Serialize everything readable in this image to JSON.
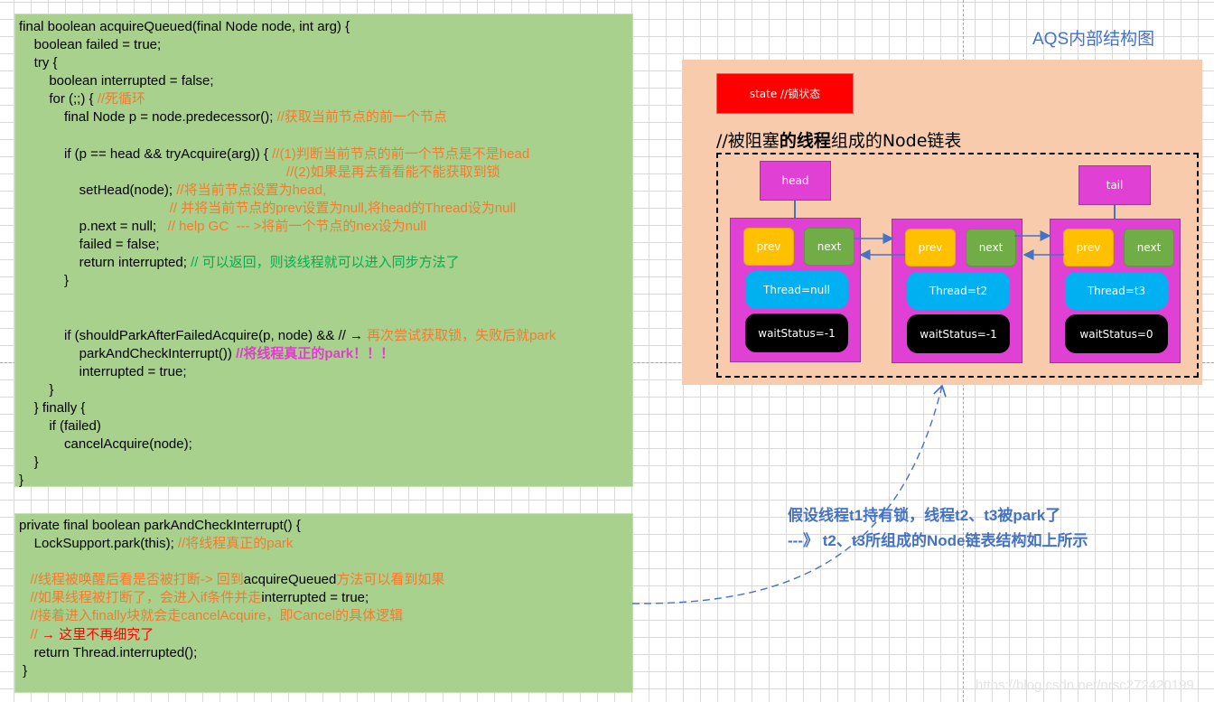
{
  "code_block_1": {
    "lines": [
      [
        {
          "t": "final boolean acquireQueued(final Node node, int arg) {",
          "c": ""
        }
      ],
      [
        {
          "t": "    boolean failed = true;",
          "c": ""
        }
      ],
      [
        {
          "t": "    try {",
          "c": ""
        }
      ],
      [
        {
          "t": "        boolean interrupted = false;",
          "c": ""
        }
      ],
      [
        {
          "t": "        for (;;) { ",
          "c": ""
        },
        {
          "t": "//死循环",
          "c": "c-orange"
        }
      ],
      [
        {
          "t": "            final Node p = node.predecessor(); ",
          "c": ""
        },
        {
          "t": "//获取当前节点的前一个节点",
          "c": "c-orange"
        }
      ],
      [
        {
          "t": "",
          "c": ""
        }
      ],
      [
        {
          "t": "            if (p == head && tryAcquire(arg)) { ",
          "c": ""
        },
        {
          "t": "//(1)判断当前节点的前一个节点是不是head",
          "c": "c-orange"
        }
      ],
      [
        {
          "t": "                                                                       ",
          "c": ""
        },
        {
          "t": "//(2)如果是再去看看能不能获取到锁",
          "c": "c-orange"
        }
      ],
      [
        {
          "t": "                setHead(node); ",
          "c": ""
        },
        {
          "t": "//将当前节点设置为head,",
          "c": "c-orange"
        }
      ],
      [
        {
          "t": "                                        ",
          "c": ""
        },
        {
          "t": "// 并将当前节点的prev设置为null,将head的Thread设为null",
          "c": "c-orange"
        }
      ],
      [
        {
          "t": "                p.next = null;   ",
          "c": ""
        },
        {
          "t": "// help GC  --- >将前一个节点的nex设为null",
          "c": "c-orange"
        }
      ],
      [
        {
          "t": "                failed = false;",
          "c": ""
        }
      ],
      [
        {
          "t": "                return interrupted; ",
          "c": ""
        },
        {
          "t": "// 可以返回，则该线程就可以进入同步方法了",
          "c": "c-green"
        }
      ],
      [
        {
          "t": "            }",
          "c": ""
        }
      ],
      [
        {
          "t": "",
          "c": ""
        }
      ],
      [
        {
          "t": "",
          "c": ""
        }
      ],
      [
        {
          "t": "            if (shouldParkAfterFailedAcquire(p, node) && // → ",
          "c": ""
        },
        {
          "t": "再次尝试获取锁，失败后就park",
          "c": "c-orange"
        }
      ],
      [
        {
          "t": "                parkAndCheckInterrupt()) ",
          "c": ""
        },
        {
          "t": "//将线程真正的park！！！",
          "c": "c-magenta"
        }
      ],
      [
        {
          "t": "                interrupted = true;",
          "c": ""
        }
      ],
      [
        {
          "t": "        }",
          "c": ""
        }
      ],
      [
        {
          "t": "    } finally {",
          "c": ""
        }
      ],
      [
        {
          "t": "        if (failed)",
          "c": ""
        }
      ],
      [
        {
          "t": "            cancelAcquire(node);",
          "c": ""
        }
      ],
      [
        {
          "t": "    }",
          "c": ""
        }
      ],
      [
        {
          "t": "}",
          "c": ""
        }
      ]
    ]
  },
  "code_block_2": {
    "lines": [
      [
        {
          "t": "private final boolean parkAndCheckInterrupt() {",
          "c": ""
        }
      ],
      [
        {
          "t": "    LockSupport.park(this); ",
          "c": ""
        },
        {
          "t": "//将线程真正的park",
          "c": "c-orange"
        }
      ],
      [
        {
          "t": "",
          "c": ""
        }
      ],
      [
        {
          "t": "   ",
          "c": ""
        },
        {
          "t": "//线程被唤醒后看是否被打断-> 回到",
          "c": "c-orange"
        },
        {
          "t": "acquireQueued",
          "c": ""
        },
        {
          "t": "方法可以看到如果",
          "c": "c-orange"
        }
      ],
      [
        {
          "t": "   ",
          "c": ""
        },
        {
          "t": "//如果线程被打断了，会进入if条件并走",
          "c": "c-orange"
        },
        {
          "t": "interrupted = true;",
          "c": ""
        }
      ],
      [
        {
          "t": "   ",
          "c": ""
        },
        {
          "t": "//接着进入finally块就会走cancelAcquire，即Cancel的具体逻辑",
          "c": "c-orange"
        }
      ],
      [
        {
          "t": "   ",
          "c": ""
        },
        {
          "t": "// ",
          "c": "c-orange"
        },
        {
          "t": "→ 这里不再细究了",
          "c": "c-red"
        }
      ],
      [
        {
          "t": "    return Thread.interrupted();",
          "c": ""
        }
      ],
      [
        {
          "t": " }",
          "c": ""
        }
      ]
    ]
  },
  "diagram": {
    "title": "AQS内部结构图",
    "state_label": "state //锁状态",
    "chain_title_parts": [
      {
        "t": "//被阻塞",
        "b": false
      },
      {
        "t": "的线程",
        "b": true
      },
      {
        "t": "组成的Node链表",
        "b": false
      }
    ],
    "head_label": "head",
    "tail_label": "tail",
    "nodes": [
      {
        "prev": "prev",
        "next": "next",
        "thread": "Thread=null",
        "wait_status": "waitStatus=-1"
      },
      {
        "prev": "prev",
        "next": "next",
        "thread": "Thread=t2",
        "wait_status": "waitStatus=-1"
      },
      {
        "prev": "prev",
        "next": "next",
        "thread": "Thread=t3",
        "wait_status": "waitStatus=0"
      }
    ]
  },
  "note": {
    "line1": "假设线程t1持有锁，线程t2、t3被park了",
    "line2": "---》 t2、t3所组成的Node链表结构如上所示"
  },
  "watermark": "https://blog.csdn.net/nrsc272420199"
}
